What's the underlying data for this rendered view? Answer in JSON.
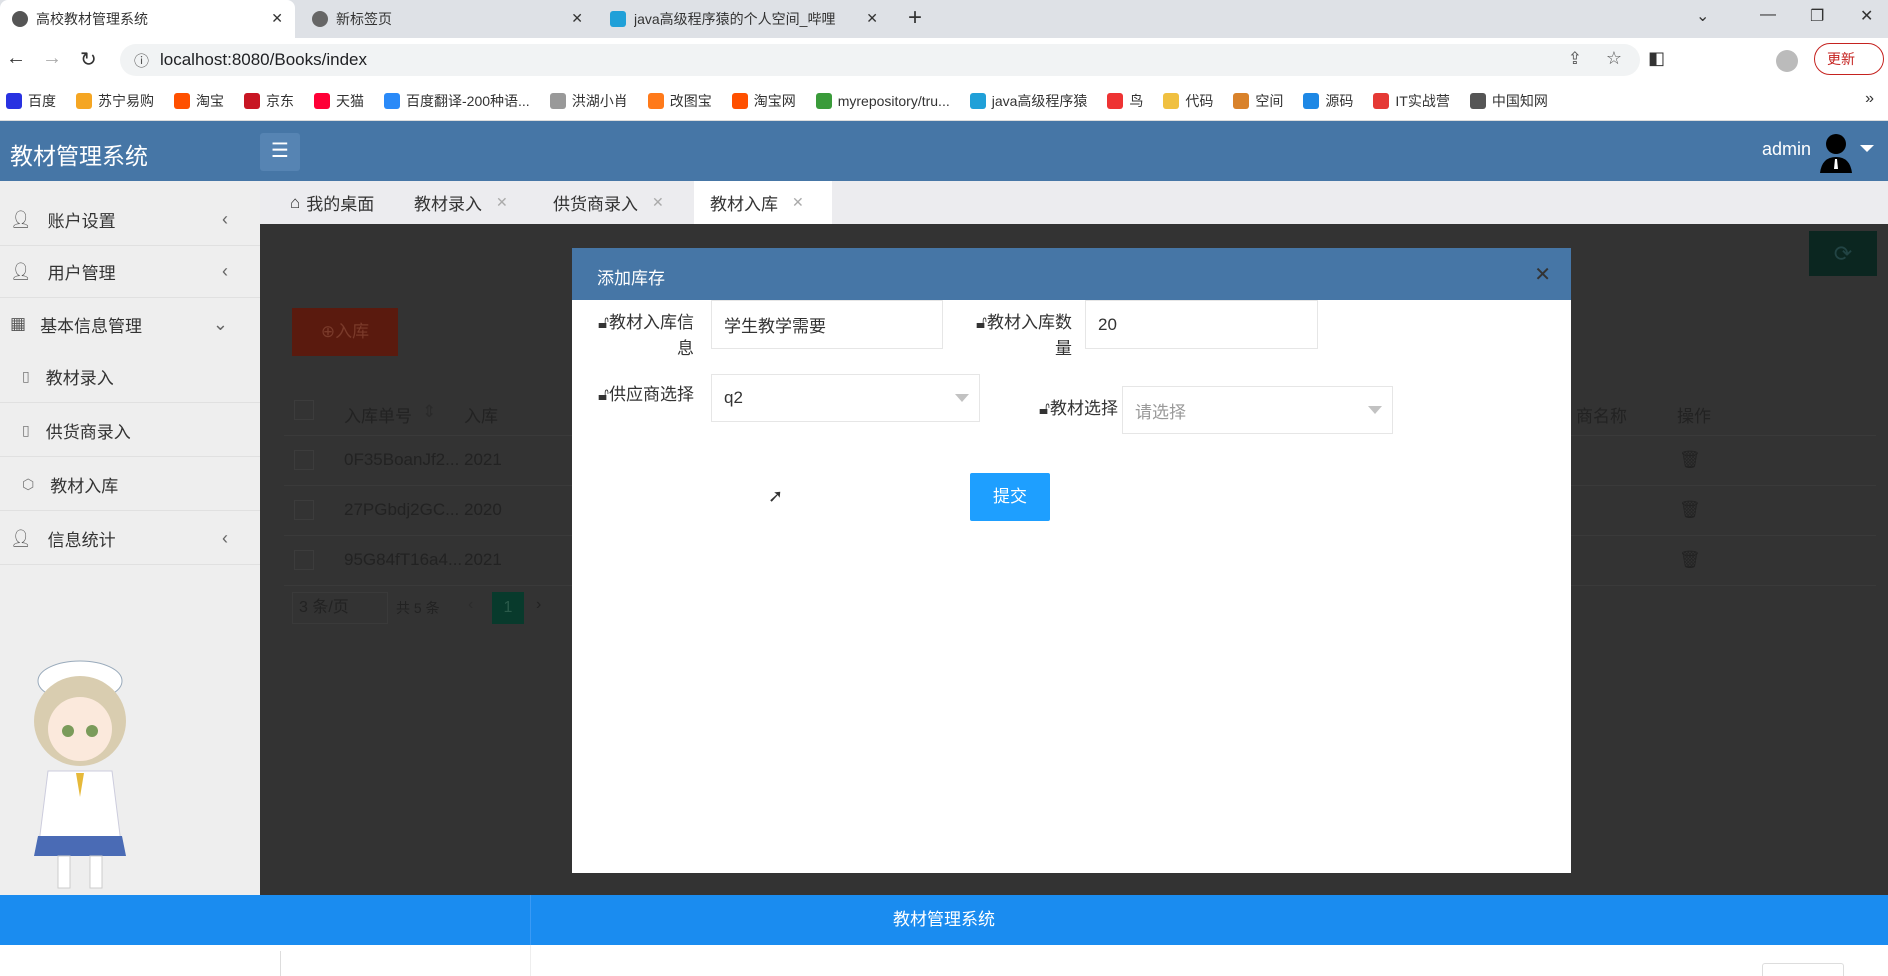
{
  "browser": {
    "tabs": [
      {
        "label": "高校教材管理系统"
      },
      {
        "label": "新标签页"
      },
      {
        "label": "java高级程序猿的个人空间_哔哩"
      }
    ],
    "url": "localhost:8080/Books/index",
    "update_label": "更新",
    "bookmarks": [
      "百度",
      "苏宁易购",
      "淘宝",
      "京东",
      "天猫",
      "百度翻译-200种语...",
      "洪湖小肖",
      "改图宝",
      "淘宝网",
      "myrepository/tru...",
      "java高级程序猿",
      "鸟",
      "代码",
      "空间",
      "源码",
      "IT实战营",
      "中国知网"
    ],
    "bookmark_colors": [
      "#2932e1",
      "#f5a623",
      "#ff5000",
      "#c81623",
      "#ff0036",
      "#2a8af8",
      "#999",
      "#ff7a1a",
      "#ff5000",
      "#3a9b3a",
      "#20a0d8",
      "#e33",
      "#f0c040",
      "#d9822b",
      "#1e88e5",
      "#e53935",
      "#555"
    ]
  },
  "app": {
    "title": "教材管理系统",
    "user": "admin",
    "sidebar": [
      {
        "label": "账户设置"
      },
      {
        "label": "用户管理"
      },
      {
        "label": "基本信息管理"
      },
      {
        "label": "教材录入"
      },
      {
        "label": "供货商录入"
      },
      {
        "label": "教材入库"
      },
      {
        "label": "信息统计"
      }
    ],
    "tabs": [
      {
        "label": "我的桌面"
      },
      {
        "label": "教材录入"
      },
      {
        "label": "供货商录入"
      },
      {
        "label": "教材入库"
      }
    ],
    "stock_in_button": "入库",
    "table": {
      "headers": [
        "入库单号",
        "入库",
        "商名称",
        "操作"
      ],
      "rows": [
        [
          "0F35BoanJf2...",
          "2021"
        ],
        [
          "27PGbdj2GC...",
          "2020"
        ],
        [
          "95G84fT16a4...",
          "2021"
        ]
      ]
    },
    "pagination": {
      "page_size": "3 条/页",
      "total": "共 5 条",
      "current": "1"
    },
    "footer": "教材管理系统",
    "accent": "#4676a6"
  },
  "modal": {
    "title": "添加库存",
    "fields": {
      "info_label": "教材入库信息",
      "info_value": "学生教学需要",
      "qty_label": "教材入库数量",
      "qty_value": "20",
      "supplier_label": "供应商选择",
      "supplier_value": "q2",
      "book_label": "教材选择",
      "book_placeholder": "请选择"
    },
    "submit": "提交"
  }
}
